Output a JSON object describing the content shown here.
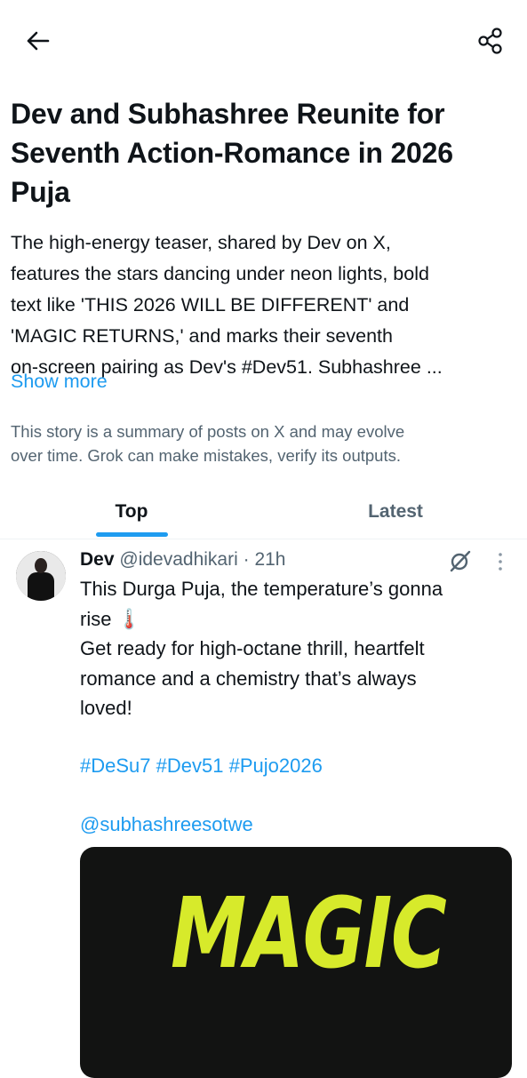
{
  "header": {
    "back_icon": "arrow-left-icon",
    "share_icon": "share-icon"
  },
  "story": {
    "title": "Dev and Subhashree Reunite for Seventh Action-Romance in 2026 Puja",
    "summary_lines": [
      "The high-energy teaser, shared by Dev on X,",
      "features the stars dancing under neon lights, bold",
      "text like 'THIS 2026 WILL BE DIFFERENT' and",
      "'MAGIC RETURNS,' and marks their seventh",
      "on-screen pairing as Dev's #Dev51. Subhashree ..."
    ],
    "show_more": "Show more",
    "disclaimer_lines": [
      "This story is a summary of posts on X and may evolve",
      "over time. Grok can make mistakes, verify its outputs."
    ]
  },
  "tabs": [
    {
      "label": "Top",
      "active": true
    },
    {
      "label": "Latest",
      "active": false
    }
  ],
  "post": {
    "name": "Dev",
    "handle": "@idevadhikari",
    "separator": "·",
    "time": "21h",
    "text_lines": [
      "This Durga Puja, the temperature’s gonna",
      "rise 🌡️",
      "Get ready for high-octane thrill, heartfelt",
      "romance and a chemistry that’s always",
      "loved!"
    ],
    "hashtags": [
      "#DeSu7",
      "#Dev51",
      "#Pujo2026"
    ],
    "mention": "@subhashreesotwe",
    "media_text": "MAGIC",
    "grok_icon": "grok-icon",
    "more_icon": "more-vertical-icon"
  },
  "colors": {
    "accent": "#1d9bf0",
    "text": "#0f1419",
    "secondary": "#536471",
    "media_text": "#d7ea2b"
  }
}
